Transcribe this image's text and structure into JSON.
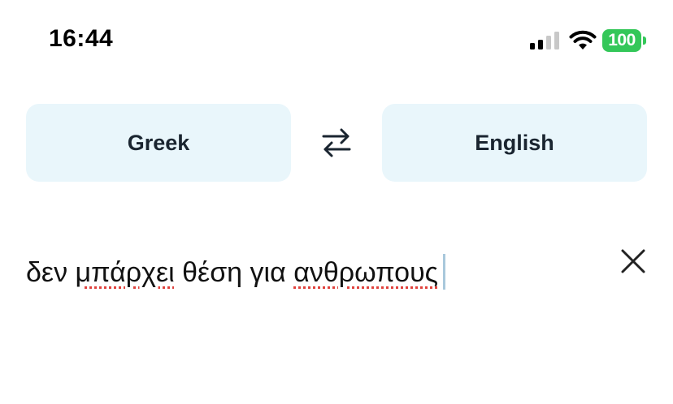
{
  "status_bar": {
    "time": "16:44",
    "battery_level": "100",
    "signal_bars_active": 2,
    "signal_bars_total": 4,
    "battery_color": "#34c759"
  },
  "language_bar": {
    "source_language": "Greek",
    "target_language": "English",
    "swap_icon": "swap-arrows-icon",
    "button_bg": "#e9f6fb"
  },
  "input": {
    "words": [
      {
        "text": "δεν",
        "misspelled": false
      },
      {
        "text": "μπάρχει",
        "misspelled": true
      },
      {
        "text": "θέση",
        "misspelled": false
      },
      {
        "text": "για",
        "misspelled": false
      },
      {
        "text": "ανθρωπους",
        "misspelled": true
      }
    ],
    "clear_icon": "close-icon",
    "spellcheck_color": "#e0413c"
  }
}
